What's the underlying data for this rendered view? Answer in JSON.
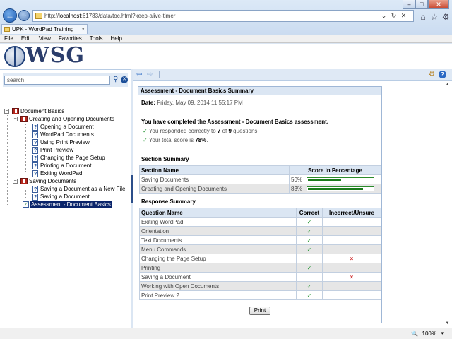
{
  "browser": {
    "url_prefix": "http://",
    "url_host": "localhost",
    "url_rest": ":61783/data/toc.html?keep-alive-timer",
    "tab_title": "UPK - WordPad Training",
    "menu": [
      "File",
      "Edit",
      "View",
      "Favorites",
      "Tools",
      "Help"
    ],
    "zoom": "100%"
  },
  "logo": {
    "text": "WSG"
  },
  "search": {
    "value": "search"
  },
  "tree": {
    "root": "Document Basics",
    "group1": "Creating and Opening Documents",
    "group1_items": [
      "Opening a Document",
      "WordPad Documents",
      "Using Print Preview",
      "Print Preview",
      "Changing the Page Setup",
      "Printing a Document",
      "Exiting WordPad"
    ],
    "group2": "Saving Documents",
    "group2_items": [
      "Saving a Document as a New File",
      "Saving a Document"
    ],
    "assessment": "Assessment - Document Basics"
  },
  "summary": {
    "title": "Assessment - Document Basics Summary",
    "date_label": "Date:",
    "date_value": "Friday, May 09, 2014 11:55:17 PM",
    "completed": "You have completed the Assessment - Document Basics assessment.",
    "responded_pre": "You responded correctly to ",
    "responded_correct": "7",
    "responded_mid": " of ",
    "responded_total": "9",
    "responded_post": " questions.",
    "score_pre": "Your total score is ",
    "score_value": "78%",
    "score_post": ".",
    "section_heading": "Section Summary",
    "section_cols": [
      "Section Name",
      "Score in Percentage"
    ],
    "sections": [
      {
        "name": "Saving Documents",
        "pct_label": "50%",
        "pct": 50
      },
      {
        "name": "Creating and Opening Documents",
        "pct_label": "83%",
        "pct": 83
      }
    ],
    "response_heading": "Response Summary",
    "response_cols": [
      "Question Name",
      "Correct",
      "Incorrect/Unsure"
    ],
    "responses": [
      {
        "name": "Exiting WordPad",
        "correct": true
      },
      {
        "name": "Orientation",
        "correct": true
      },
      {
        "name": "Text Documents",
        "correct": true
      },
      {
        "name": "Menu Commands",
        "correct": true
      },
      {
        "name": "Changing the Page Setup",
        "correct": false
      },
      {
        "name": "Printing",
        "correct": true
      },
      {
        "name": "Saving a Document",
        "correct": false
      },
      {
        "name": "Working with Open Documents",
        "correct": true
      },
      {
        "name": "Print Preview 2",
        "correct": true
      }
    ],
    "print_label": "Print",
    "check_glyph": "✓",
    "x_glyph": "×"
  },
  "colors": {
    "accent": "#0a246a",
    "bar": "#1a7a1a",
    "header": "#dbe6f3"
  }
}
